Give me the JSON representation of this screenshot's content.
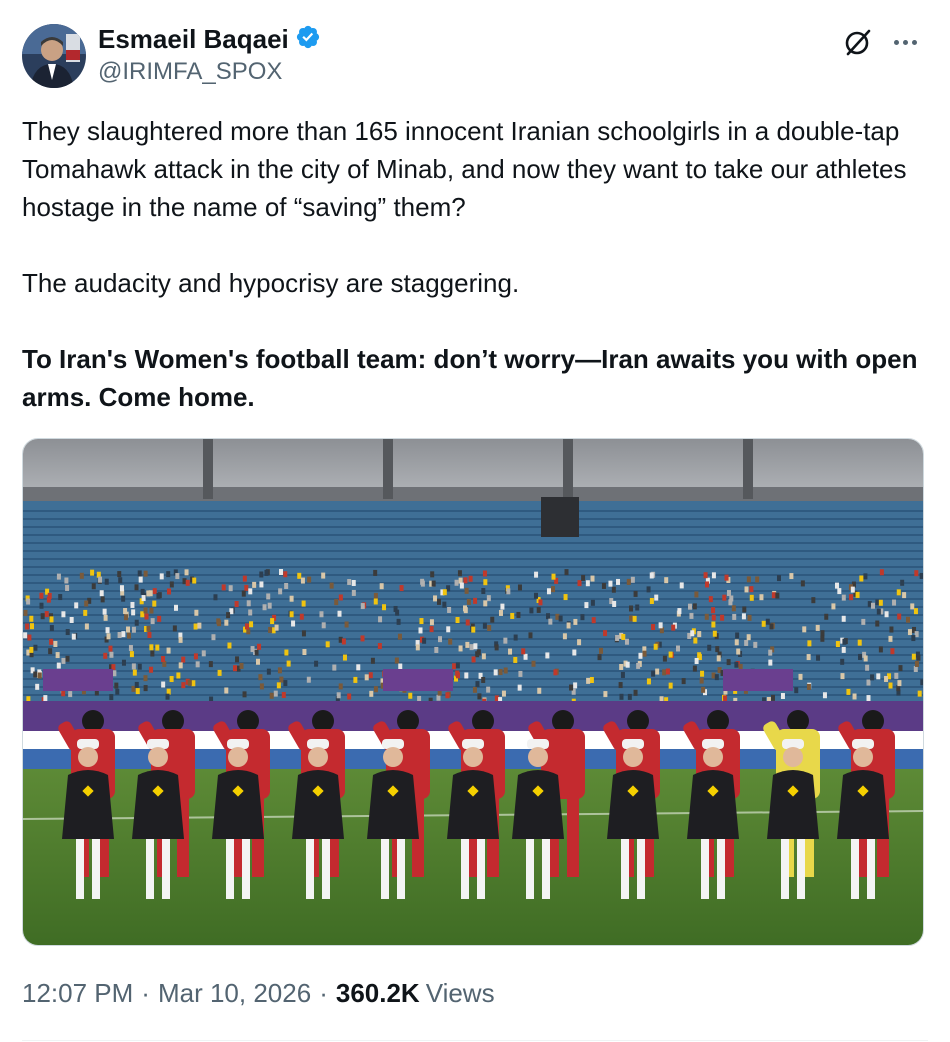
{
  "tweet": {
    "author_name": "Esmaeil Baqaei",
    "author_handle": "@IRIMFA_SPOX",
    "verified_icon": "verified-badge-icon",
    "paragraph_1": "They slaughtered more than 165 innocent Iranian schoolgirls in a double-tap Tomahawk attack in the city of Minab, and now they want to take our athletes hostage in the name of “saving” them?",
    "paragraph_2": "The audacity and hypocrisy are staggering.",
    "paragraph_3": "To Iran's Women's football team: don’t worry—Iran awaits you with open arms. Come home.",
    "time": "12:07 PM",
    "date": "Mar 10, 2026",
    "separator": "·",
    "views_count": "360.2K",
    "views_label": "Views"
  },
  "colors": {
    "text": "#0f1419",
    "secondary": "#536471",
    "verified": "#1d9bf0",
    "jersey_red": "#c42a2f",
    "pitch_green": "#4d7a2c"
  },
  "icons": [
    "grok-icon",
    "more-icon",
    "verified-badge-icon"
  ]
}
